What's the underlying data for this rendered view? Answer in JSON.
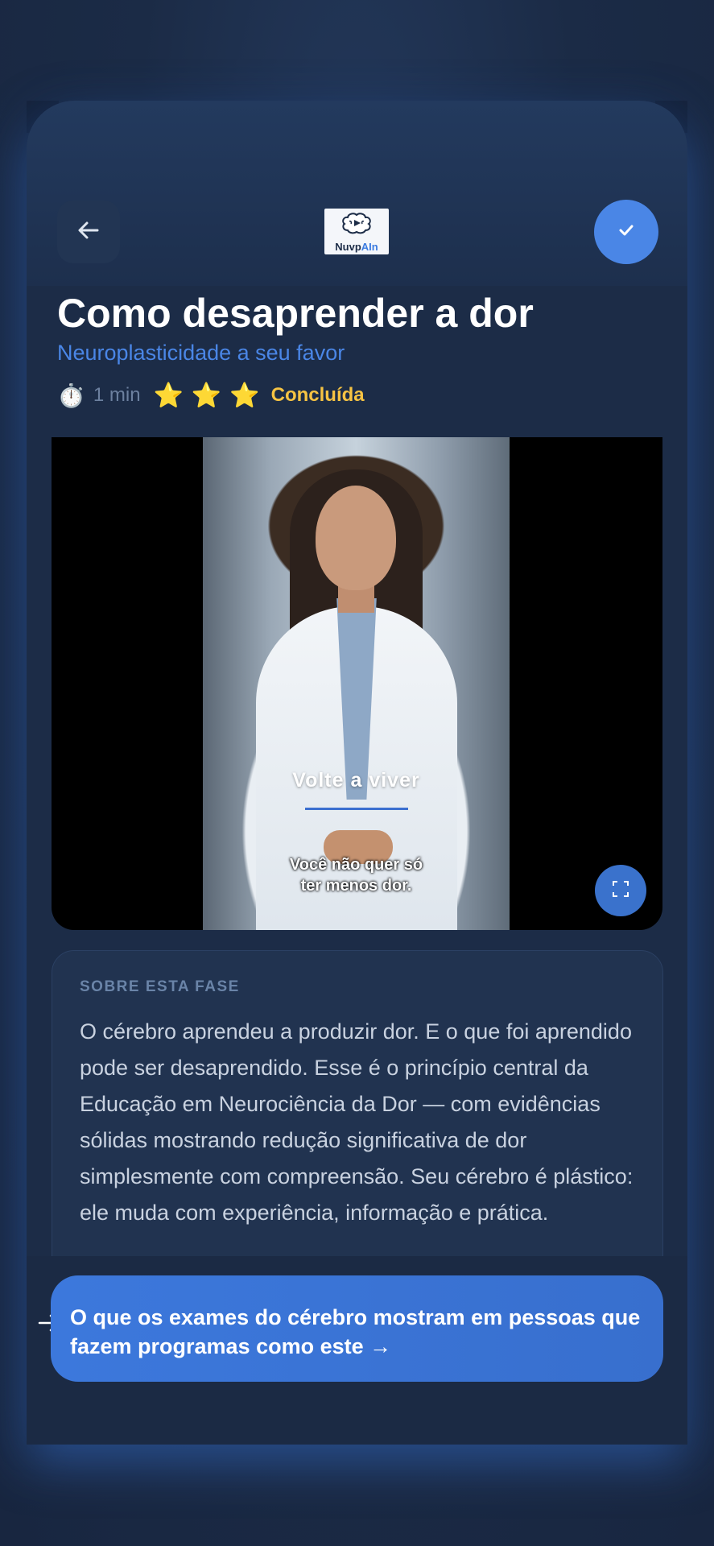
{
  "header": {
    "back_icon": "arrow-left-icon",
    "logo_text_main": "Nuvp",
    "logo_text_accent": "AIn",
    "done_icon": "check-icon"
  },
  "lesson": {
    "title": "Como desaprender a dor",
    "subtitle": "Neuroplasticidade a seu favor",
    "timer_emoji": "⏱️",
    "duration": "1 min",
    "stars": [
      "⭐",
      "⭐",
      "⭐"
    ],
    "status": "Concluída"
  },
  "video": {
    "overlay_title": "Volte a viver",
    "caption_line1": "Você não quer só",
    "caption_line2": "ter menos dor.",
    "fullscreen_icon": "fullscreen-icon"
  },
  "about": {
    "heading": "SOBRE ESTA FASE",
    "text": "O cérebro aprendeu a produzir dor. E o que foi aprendido pode ser desaprendido. Esse é o princípio central da Educação em Neurociência da Dor — com evidências sólidas mostrando redução significativa de dor simplesmente com compreensão. Seu cérebro é plástico: ele muda com experiência, informação e prática."
  },
  "cta": {
    "label": "O que os exames do cérebro mostram em pessoas que fazem programas como este →"
  },
  "colors": {
    "accent": "#4a86e6",
    "star": "#f6c343",
    "background": "#1c2c47"
  }
}
